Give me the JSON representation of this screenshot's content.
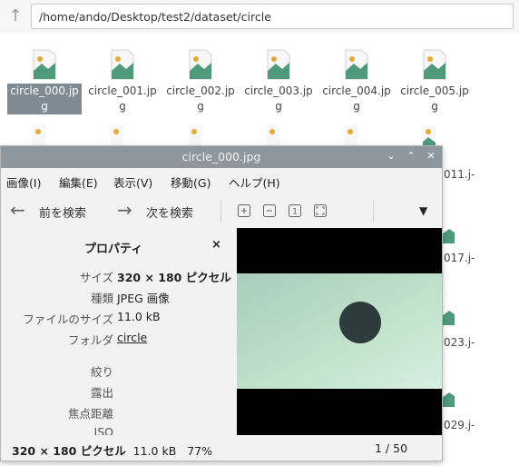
{
  "file_manager": {
    "path": "/home/ando/Desktop/test2/dataset/circle",
    "files": [
      {
        "name": "circle_000.jpg",
        "selected": true
      },
      {
        "name": "circle_001.jpg",
        "selected": false
      },
      {
        "name": "circle_002.jpg",
        "selected": false
      },
      {
        "name": "circle_003.jpg",
        "selected": false
      },
      {
        "name": "circle_004.jpg",
        "selected": false
      },
      {
        "name": "circle_005.jpg",
        "selected": false
      }
    ],
    "partial_labels": [
      "011.j-",
      "017.j-",
      "023.j-",
      "029.j-"
    ]
  },
  "viewer": {
    "title": "circle_000.jpg",
    "menu": [
      "画像(I)",
      "編集(E)",
      "表示(V)",
      "移動(G)",
      "ヘルプ(H)"
    ],
    "toolbar": {
      "prev_label": "前を検索",
      "next_label": "次を検索"
    },
    "properties": {
      "title": "プロパティ",
      "close_glyph": "×",
      "rows": [
        {
          "key": "サイズ",
          "value": "320 × 180 ピクセル"
        },
        {
          "key": "種類",
          "value": "JPEG 画像"
        },
        {
          "key": "ファイルのサイズ",
          "value": "11.0 kB"
        },
        {
          "key": "フォルダ",
          "value": "circle"
        },
        {
          "key": "絞り",
          "value": ""
        },
        {
          "key": "露出",
          "value": ""
        },
        {
          "key": "焦点距離",
          "value": ""
        },
        {
          "key": "ISO",
          "value": ""
        }
      ]
    },
    "status": {
      "dimensions": "320 × 180 ピクセル",
      "size": "11.0 kB",
      "zoom": "77%",
      "position": "1 / 50"
    }
  },
  "colors": {
    "titlebar": "#8e979e",
    "selection": "#7f8a93",
    "image_bg_light": "#c2e4cb",
    "image_bg_dark": "#9bc3b2",
    "circle": "#2d3b3c"
  }
}
